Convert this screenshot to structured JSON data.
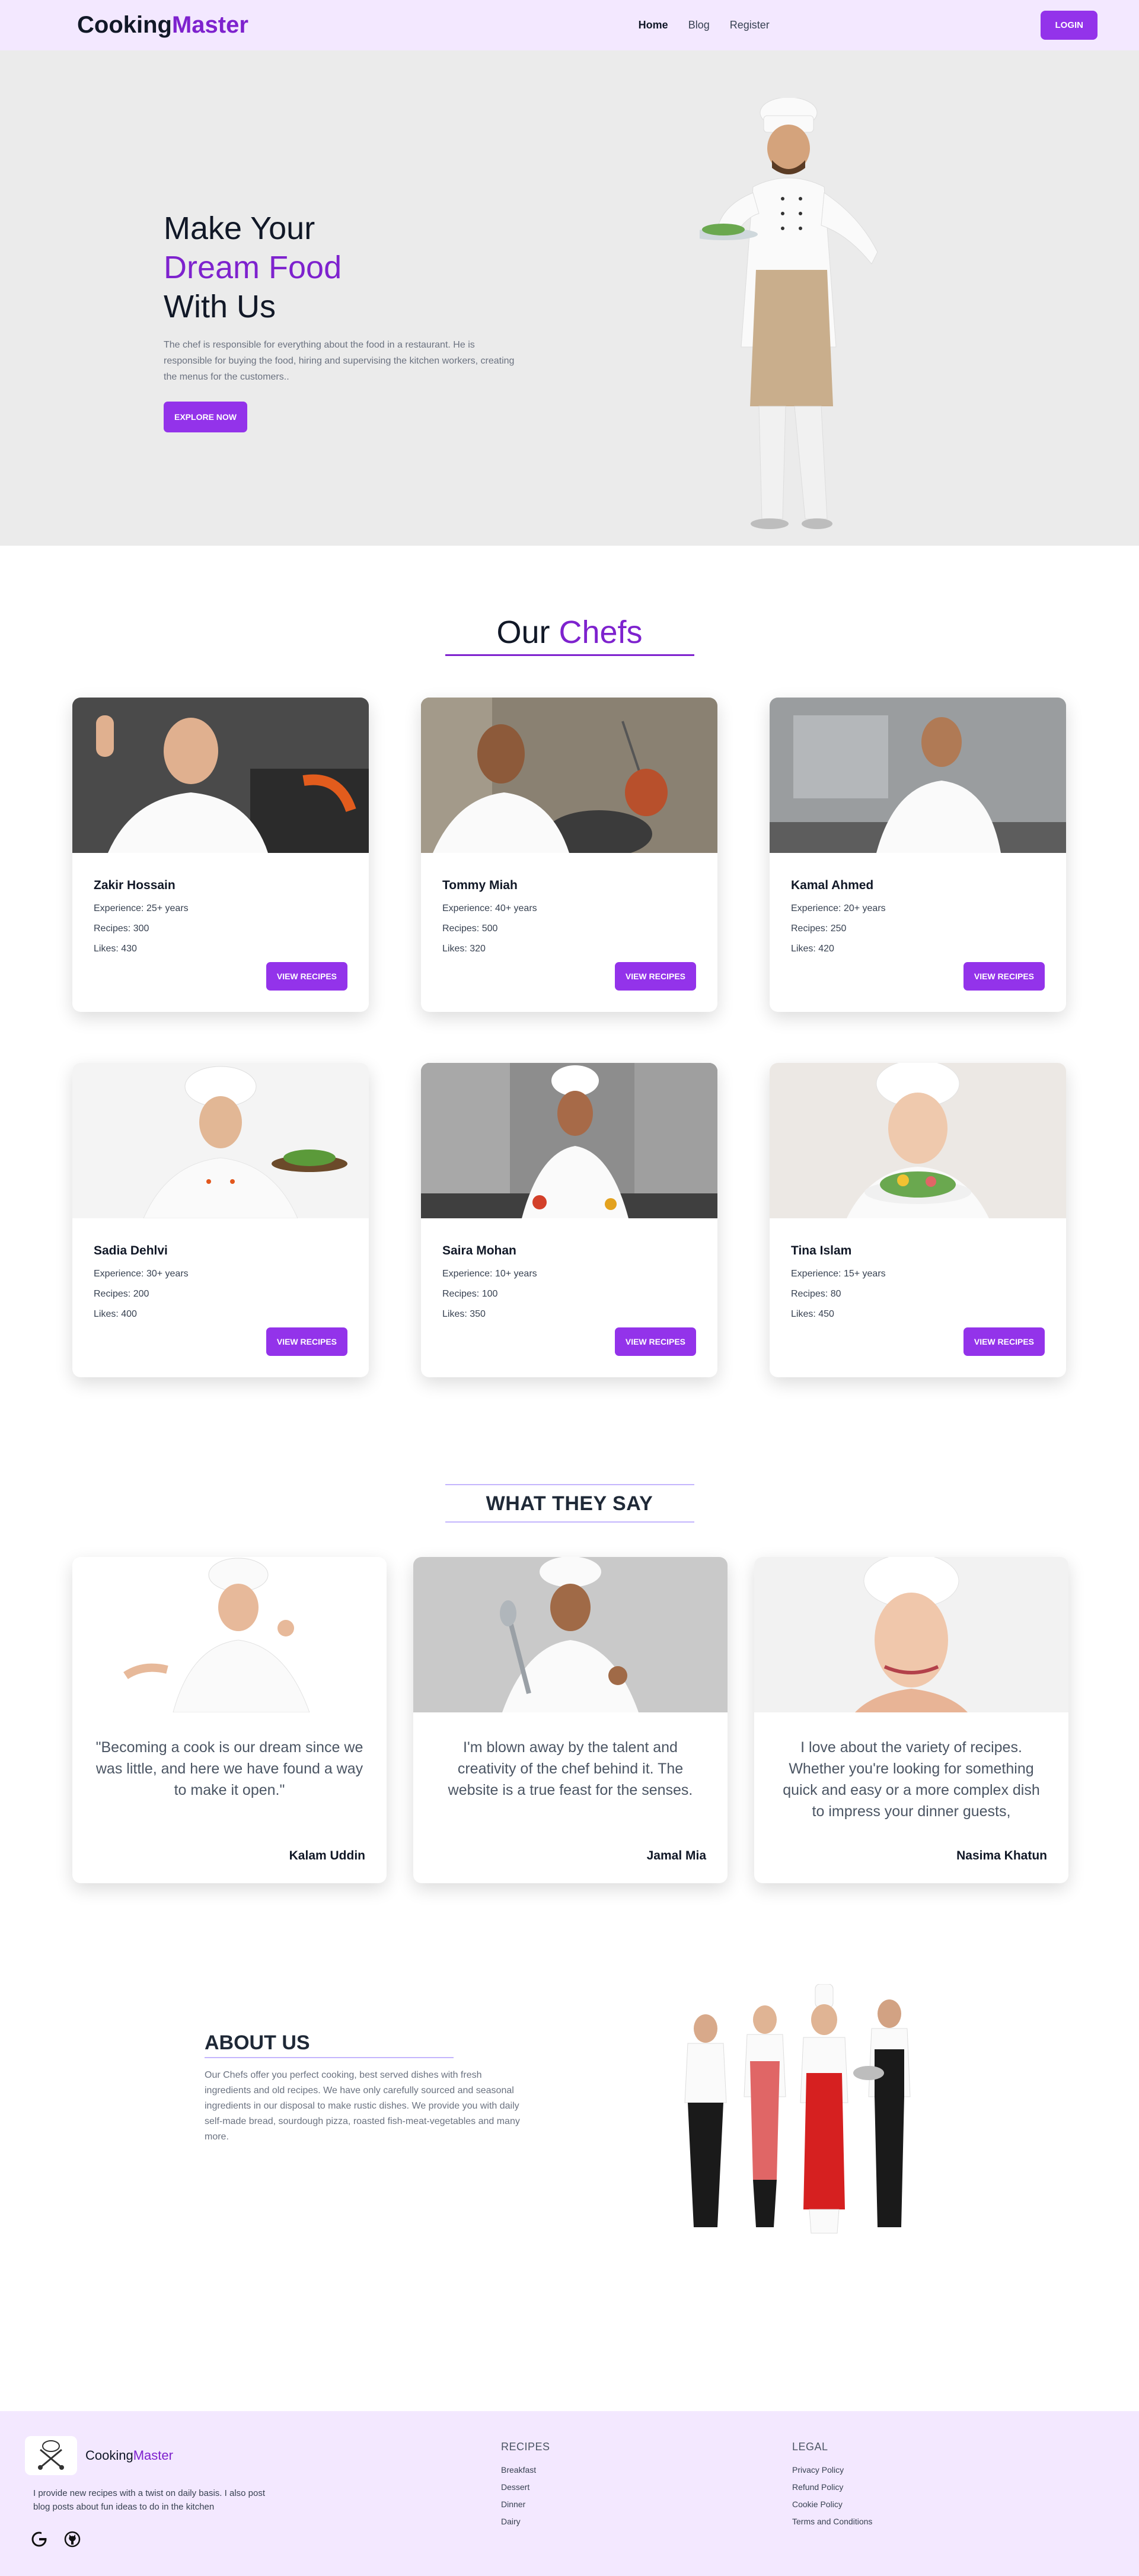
{
  "nav": {
    "logo_main": "Cooking",
    "logo_accent": "Master",
    "links": [
      "Home",
      "Blog",
      "Register"
    ],
    "login_label": "LOGIN"
  },
  "hero": {
    "line1": "Make Your",
    "line2": "Dream Food",
    "line3": "With Us",
    "description": "The chef is responsible for everything about the food in a restaurant. He is responsible for buying the food, hiring and supervising the kitchen workers, creating the menus for the customers..",
    "button_label": "EXPLORE NOW"
  },
  "chefs_section": {
    "title_main": "Our",
    "title_accent": "Chefs",
    "chefs": [
      {
        "name": "Zakir Hossain",
        "experience": "Experience: 25+ years",
        "recipes": "Recipes: 300",
        "likes": "Likes: 430",
        "button": "VIEW RECIPES"
      },
      {
        "name": "Tommy Miah",
        "experience": "Experience: 40+ years",
        "recipes": "Recipes: 500",
        "likes": "Likes: 320",
        "button": "VIEW RECIPES"
      },
      {
        "name": "Kamal Ahmed",
        "experience": "Experience: 20+ years",
        "recipes": "Recipes: 250",
        "likes": "Likes: 420",
        "button": "VIEW RECIPES"
      },
      {
        "name": "Sadia Dehlvi",
        "experience": "Experience: 30+ years",
        "recipes": "Recipes: 200",
        "likes": "Likes: 400",
        "button": "VIEW RECIPES"
      },
      {
        "name": "Saira Mohan",
        "experience": "Experience: 10+ years",
        "recipes": "Recipes: 100",
        "likes": "Likes: 350",
        "button": "VIEW RECIPES"
      },
      {
        "name": "Tina Islam",
        "experience": "Experience: 15+ years",
        "recipes": "Recipes: 80",
        "likes": "Likes: 450",
        "button": "VIEW RECIPES"
      }
    ]
  },
  "testimonials": {
    "title": "WHAT THEY SAY",
    "items": [
      {
        "quote": "\"Becoming a cook is our dream since we was little, and here we have found a way to make it open.\"",
        "author": "Kalam Uddin"
      },
      {
        "quote": "I'm blown away by the talent and creativity of the chef behind it. The website is a true feast for the senses.",
        "author": "Jamal Mia"
      },
      {
        "quote": "I love about the variety of recipes. Whether you're looking for something quick and easy or a more complex dish to impress your dinner guests,",
        "author": "Nasima Khatun"
      }
    ]
  },
  "about": {
    "title": "ABOUT US",
    "description": "Our Chefs offer you perfect cooking, best served dishes with fresh ingredients and old recipes. We have only carefully sourced and seasonal ingredients in our disposal to make rustic dishes. We provide you with daily self-made bread, sourdough pizza, roasted fish-meat-vegetables and many more."
  },
  "footer": {
    "brand_main": "Cooking",
    "brand_accent": "Master",
    "description": "I provide new recipes with a twist on daily basis. I also post blog posts about fun ideas to do in the kitchen",
    "recipes_title": "RECIPES",
    "recipes_links": [
      "Breakfast",
      "Dessert",
      "Dinner",
      "Dairy"
    ],
    "legal_title": "LEGAL",
    "legal_links": [
      "Privacy Policy",
      "Refund Policy",
      "Cookie Policy",
      "Terms and Conditions"
    ],
    "social_icons": [
      "google-icon",
      "github-icon"
    ]
  },
  "colors": {
    "accent": "#9333ea",
    "accent_text": "#7e22ce",
    "nav_bg": "#f3e8ff",
    "hero_bg": "#ebebeb"
  }
}
